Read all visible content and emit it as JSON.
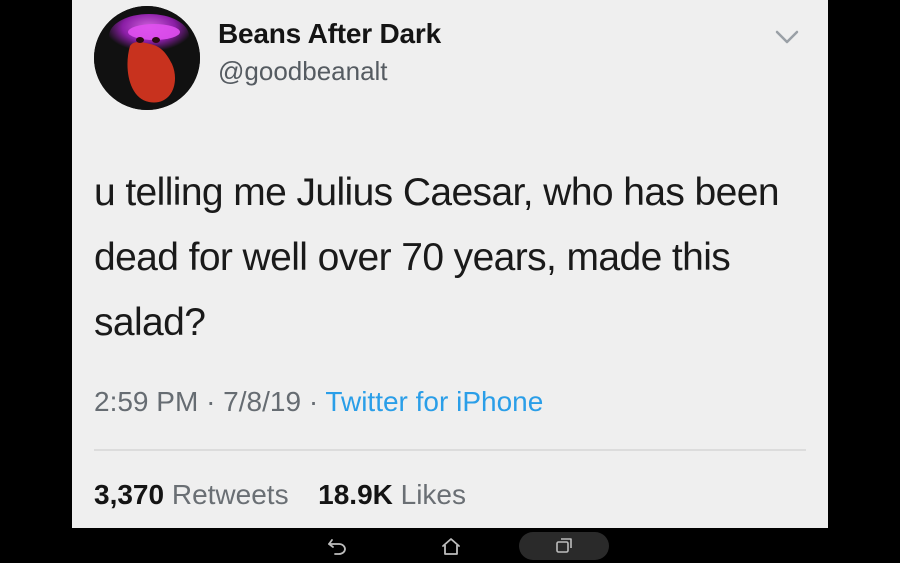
{
  "tweet": {
    "display_name": "Beans After Dark",
    "handle": "@goodbeanalt",
    "text": "u telling me Julius Caesar, who has been dead for well over 70 years, made this salad?",
    "time": "2:59 PM",
    "separator": "·",
    "date": "7/8/19",
    "source": "Twitter for iPhone",
    "retweets_count": "3,370",
    "retweets_label": "Retweets",
    "likes_count": "18.9K",
    "likes_label": "Likes"
  },
  "icons": {
    "avatar": "bean-avatar",
    "more": "chevron-down-icon",
    "nav_back": "back-icon",
    "nav_home": "home-icon",
    "nav_recents": "recents-icon"
  },
  "colors": {
    "card_background": "#efefef",
    "source_link": "#2a9ee8",
    "avatar_bean": "#c8321e",
    "avatar_glow": "#d845e8"
  }
}
